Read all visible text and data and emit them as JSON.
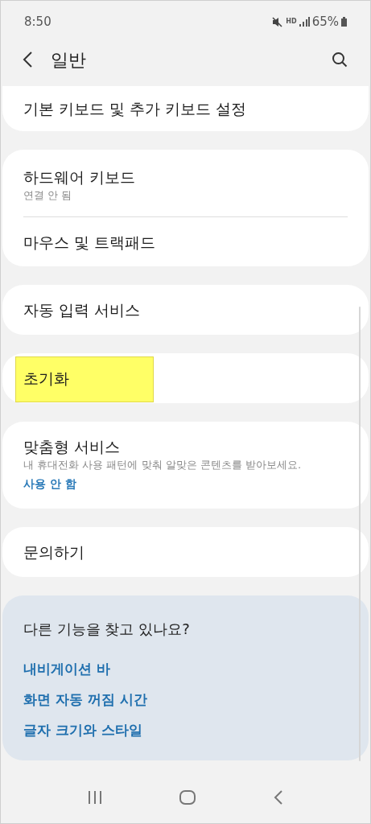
{
  "status_bar": {
    "time": "8:50",
    "hd_label": "HD",
    "battery": "65%"
  },
  "header": {
    "title": "일반"
  },
  "groups": [
    {
      "items": [
        {
          "title": "기본 키보드 및 추가 키보드 설정",
          "highlighted": false
        }
      ]
    },
    {
      "items": [
        {
          "title": "하드웨어 키보드",
          "subtitle": "연결 안 됨",
          "highlighted": false
        },
        {
          "title": "마우스 및 트랙패드",
          "highlighted": false
        }
      ]
    },
    {
      "items": [
        {
          "title": "자동 입력 서비스",
          "highlighted": false
        }
      ]
    },
    {
      "items": [
        {
          "title": "초기화",
          "highlighted": true
        }
      ]
    },
    {
      "items": [
        {
          "title": "맞춤형 서비스",
          "subtitle": "내 휴대전화 사용 패턴에 맞춰 알맞은 콘텐츠를 받아보세요.",
          "link": "사용 안 함",
          "highlighted": false
        }
      ]
    },
    {
      "items": [
        {
          "title": "문의하기",
          "highlighted": false
        }
      ]
    }
  ],
  "suggestions": {
    "title": "다른 기능을 찾고 있나요?",
    "links": [
      "내비게이션 바",
      "화면 자동 꺼짐 시간",
      "글자 크기와 스타일"
    ]
  }
}
